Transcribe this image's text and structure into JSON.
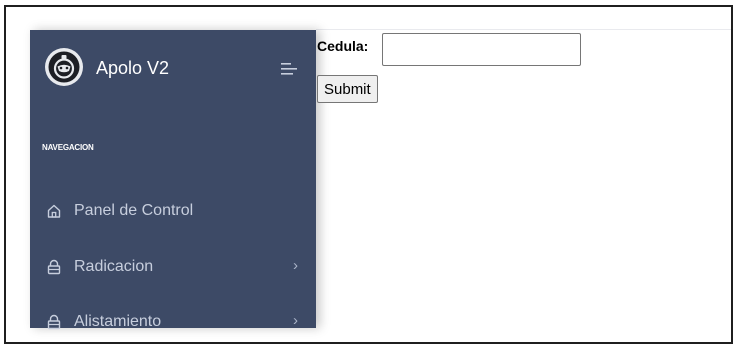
{
  "app": {
    "brand_name": "Apolo V2"
  },
  "sidebar": {
    "heading": "NAVEGACION",
    "items": [
      {
        "label": "Panel de Control",
        "icon": "home-icon",
        "has_submenu": false
      },
      {
        "label": "Radicacion",
        "icon": "lock-icon",
        "has_submenu": true,
        "chevron": "›"
      },
      {
        "label": "Alistamiento",
        "icon": "lock-icon",
        "has_submenu": true,
        "chevron": "›"
      }
    ]
  },
  "form": {
    "cedula_label": "Cedula:",
    "cedula_value": "",
    "submit_label": "Submit"
  },
  "colors": {
    "sidebar_bg": "#3d4a66",
    "sidebar_text": "#c7cedd",
    "brand_text": "#ffffff"
  }
}
